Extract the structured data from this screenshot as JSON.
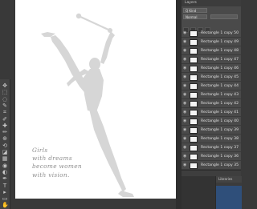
{
  "app": {
    "accent": "#2f4f7a",
    "canvas_color": "#ffffff",
    "silhouette_color": "#d6d6d6"
  },
  "layers_panel": {
    "title": "Layers",
    "kind_label": "Q Kind",
    "mode_label": "Normal",
    "layers": [
      "Rectangle 1 copy 50",
      "Rectangle 1 copy 49",
      "Rectangle 1 copy 48",
      "Rectangle 1 copy 47",
      "Rectangle 1 copy 46",
      "Rectangle 1 copy 45",
      "Rectangle 1 copy 44",
      "Rectangle 1 copy 43",
      "Rectangle 1 copy 42",
      "Rectangle 1 copy 41",
      "Rectangle 1 copy 40",
      "Rectangle 1 copy 39",
      "Rectangle 1 copy 38",
      "Rectangle 1 copy 37",
      "Rectangle 1 copy 36",
      "Rectangle 1 copy 35"
    ]
  },
  "lower_panel": {
    "tab": "Libraries"
  },
  "canvas": {
    "poem_lines": [
      "Girls",
      "with dreams",
      "become women",
      "with vision."
    ]
  },
  "toolbar": {
    "tools": [
      "move-tool",
      "marquee-tool",
      "lasso-tool",
      "quick-select-tool",
      "crop-tool",
      "eyedropper-tool",
      "healing-tool",
      "brush-tool",
      "stamp-tool",
      "history-brush-tool",
      "eraser-tool",
      "gradient-tool",
      "blur-tool",
      "dodge-tool",
      "pen-tool",
      "type-tool",
      "path-select-tool",
      "shape-tool",
      "hand-tool"
    ]
  }
}
